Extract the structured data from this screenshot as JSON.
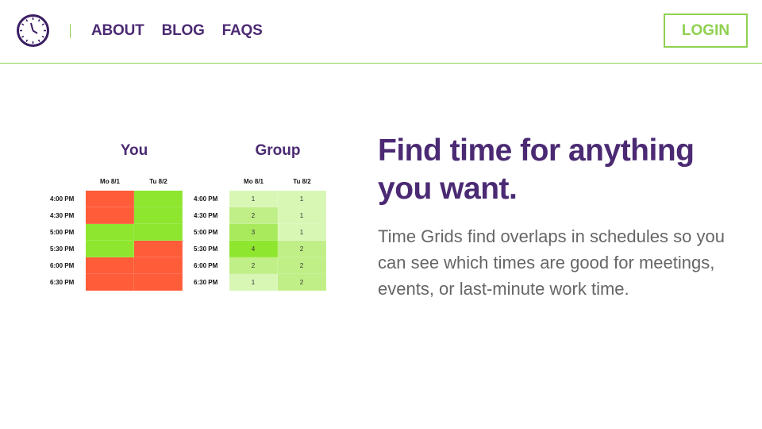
{
  "nav": {
    "items": [
      {
        "label": "ABOUT"
      },
      {
        "label": "BLOG"
      },
      {
        "label": "FAQS"
      }
    ],
    "login_label": "LOGIN"
  },
  "colors": {
    "brand_purple": "#4b2a73",
    "accent_green": "#8fd14f",
    "busy_red": "#ff5c39",
    "free_green": "#8ee62e"
  },
  "logo_icon": "clock-icon",
  "hero": {
    "headline": "Find time for anything you want.",
    "subtext": "Time Grids find overlaps in schedules so you can see which times are good for meetings, events, or last-minute work time."
  },
  "you_grid": {
    "title": "You",
    "columns": [
      "Mo 8/1",
      "Tu 8/2"
    ],
    "rows": [
      {
        "time": "4:00 PM",
        "cells": [
          "busy",
          "free"
        ]
      },
      {
        "time": "4:30 PM",
        "cells": [
          "busy",
          "free"
        ]
      },
      {
        "time": "5:00 PM",
        "cells": [
          "free",
          "free"
        ]
      },
      {
        "time": "5:30 PM",
        "cells": [
          "free",
          "busy"
        ]
      },
      {
        "time": "6:00 PM",
        "cells": [
          "busy",
          "busy"
        ]
      },
      {
        "time": "6:30 PM",
        "cells": [
          "busy",
          "busy"
        ]
      }
    ]
  },
  "group_grid": {
    "title": "Group",
    "columns": [
      "Mo 8/1",
      "Tu 8/2"
    ],
    "rows": [
      {
        "time": "4:00 PM",
        "cells": [
          1,
          1
        ]
      },
      {
        "time": "4:30 PM",
        "cells": [
          2,
          1
        ]
      },
      {
        "time": "5:00 PM",
        "cells": [
          3,
          1
        ]
      },
      {
        "time": "5:30 PM",
        "cells": [
          4,
          2
        ]
      },
      {
        "time": "6:00 PM",
        "cells": [
          2,
          2
        ]
      },
      {
        "time": "6:30 PM",
        "cells": [
          1,
          2
        ]
      }
    ]
  }
}
